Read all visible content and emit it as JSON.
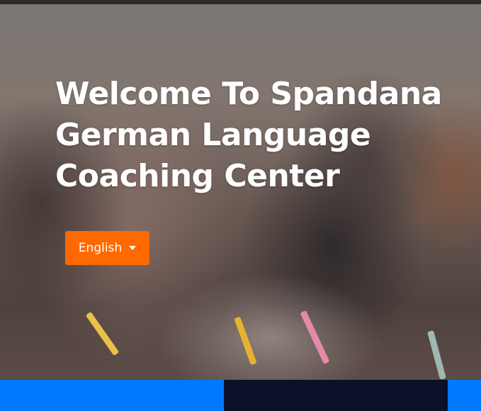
{
  "hero": {
    "title": "Welcome To Spandana German Language Coaching Center",
    "background_image": "students-writing-in-classroom"
  },
  "language_selector": {
    "selected": "English",
    "icon": "chevron-down-icon",
    "color": "#ff6a00"
  },
  "colors": {
    "accent_orange": "#ff6a00",
    "strip_blue": "#0179fe",
    "strip_dark": "#0b1128"
  }
}
